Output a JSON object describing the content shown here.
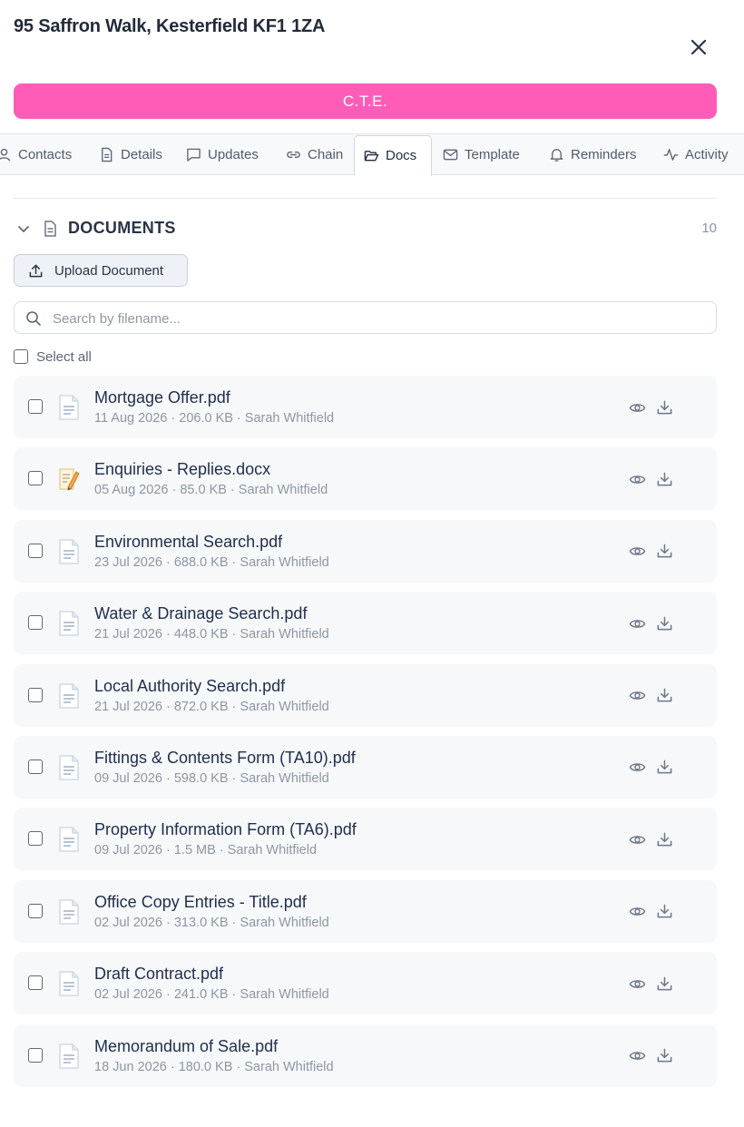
{
  "header": {
    "title": "95 Saffron Walk, Kesterfield KF1 1ZA",
    "close_icon": "close-icon"
  },
  "status": {
    "label": "C.T.E.",
    "color": "#ff5cb8"
  },
  "tabs": [
    {
      "label": "Contacts",
      "icon": "person-icon",
      "active": false
    },
    {
      "label": "Details",
      "icon": "file-text-icon",
      "active": false
    },
    {
      "label": "Updates",
      "icon": "message-square-icon",
      "active": false
    },
    {
      "label": "Chain",
      "icon": "link-icon",
      "active": false
    },
    {
      "label": "Docs",
      "icon": "folder-open-icon",
      "active": true
    },
    {
      "label": "Template",
      "icon": "mail-icon",
      "active": false
    },
    {
      "label": "Reminders",
      "icon": "bell-icon",
      "active": false
    },
    {
      "label": "Activity",
      "icon": "activity-icon",
      "active": false
    }
  ],
  "documents": {
    "title": "DOCUMENTS",
    "count": "10",
    "upload_label": "Upload Document",
    "search_placeholder": "Search by filename...",
    "select_all_label": "Select all",
    "items": [
      {
        "name": "Mortgage Offer.pdf",
        "meta": "11 Aug 2026 · 206.0 KB · Sarah Whitfield",
        "icon": "pdf-file-icon"
      },
      {
        "name": "Enquiries - Replies.docx",
        "meta": "05 Aug 2026 · 85.0 KB · Sarah Whitfield",
        "icon": "word-file-icon"
      },
      {
        "name": "Environmental Search.pdf",
        "meta": "23 Jul 2026 · 688.0 KB · Sarah Whitfield",
        "icon": "pdf-file-icon"
      },
      {
        "name": "Water & Drainage Search.pdf",
        "meta": "21 Jul 2026 · 448.0 KB · Sarah Whitfield",
        "icon": "pdf-file-icon"
      },
      {
        "name": "Local Authority Search.pdf",
        "meta": "21 Jul 2026 · 872.0 KB · Sarah Whitfield",
        "icon": "pdf-file-icon"
      },
      {
        "name": "Fittings & Contents Form (TA10).pdf",
        "meta": "09 Jul 2026 · 598.0 KB · Sarah Whitfield",
        "icon": "pdf-file-icon"
      },
      {
        "name": "Property Information Form (TA6).pdf",
        "meta": "09 Jul 2026 · 1.5 MB · Sarah Whitfield",
        "icon": "pdf-file-icon"
      },
      {
        "name": "Office Copy Entries - Title.pdf",
        "meta": "02 Jul 2026 · 313.0 KB · Sarah Whitfield",
        "icon": "pdf-file-icon"
      },
      {
        "name": "Draft Contract.pdf",
        "meta": "02 Jul 2026 · 241.0 KB · Sarah Whitfield",
        "icon": "pdf-file-icon"
      },
      {
        "name": "Memorandum of Sale.pdf",
        "meta": "18 Jun 2026 · 180.0 KB · Sarah Whitfield",
        "icon": "pdf-file-icon"
      }
    ]
  }
}
